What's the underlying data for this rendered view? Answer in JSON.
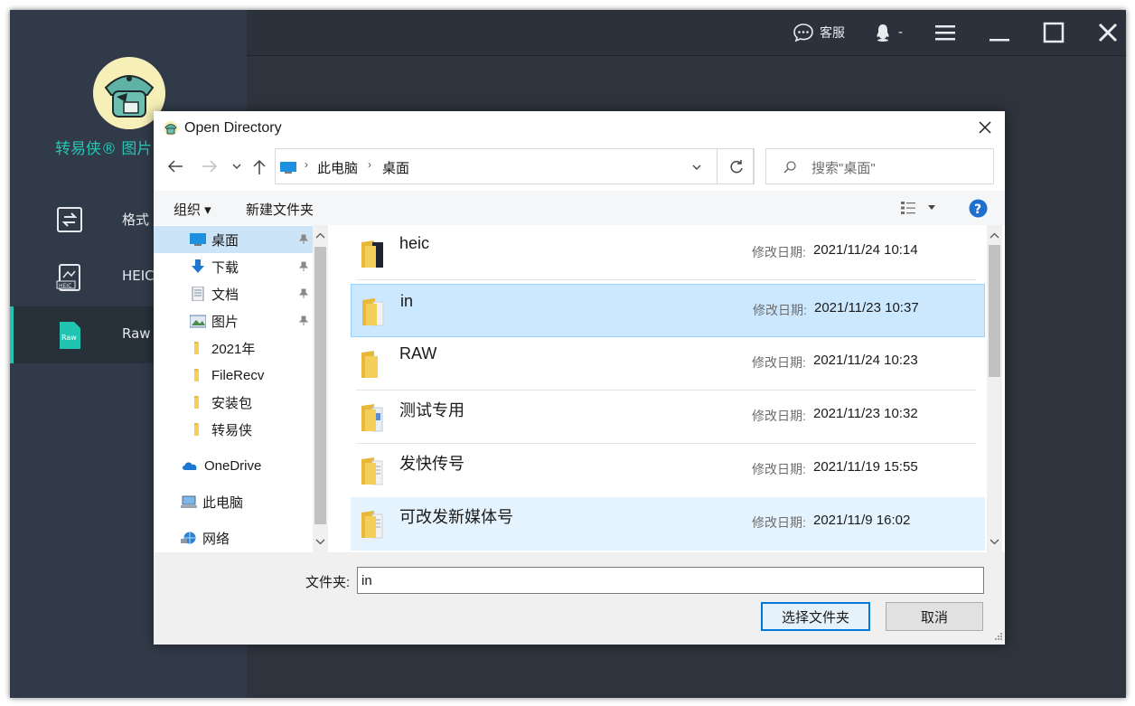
{
  "app": {
    "brand": "转易侠® 图片",
    "topbar": {
      "service_label": "客服",
      "user_label": "-"
    },
    "nav": [
      {
        "label": "格式",
        "icon": "convert-icon"
      },
      {
        "label": "HEIC",
        "icon": "heic-icon"
      },
      {
        "label": "Raw",
        "icon": "raw-icon"
      }
    ]
  },
  "dialog": {
    "title": "Open Directory",
    "breadcrumb": [
      "此电脑",
      "桌面"
    ],
    "search_placeholder": "搜索\"桌面\"",
    "toolbar": {
      "organize": "组织 ▾",
      "new_folder": "新建文件夹"
    },
    "tree": [
      {
        "label": "桌面",
        "pinned": true
      },
      {
        "label": "下载",
        "pinned": true
      },
      {
        "label": "文档",
        "pinned": true
      },
      {
        "label": "图片",
        "pinned": true
      },
      {
        "label": "2021年",
        "pinned": false
      },
      {
        "label": "FileRecv",
        "pinned": false
      },
      {
        "label": "安装包",
        "pinned": false
      },
      {
        "label": "转易侠",
        "pinned": false
      },
      {
        "label": "OneDrive",
        "pinned": false
      },
      {
        "label": "此电脑",
        "pinned": false
      },
      {
        "label": "网络",
        "pinned": false
      }
    ],
    "date_label": "修改日期:",
    "files": [
      {
        "name": "heic",
        "date": "2021/11/24 10:14"
      },
      {
        "name": "in",
        "date": "2021/11/23 10:37"
      },
      {
        "name": "RAW",
        "date": "2021/11/24 10:23"
      },
      {
        "name": "测试专用",
        "date": "2021/11/23 10:32"
      },
      {
        "name": "发快传号",
        "date": "2021/11/19 15:55"
      },
      {
        "name": "可改发新媒体号",
        "date": "2021/11/9 16:02"
      }
    ],
    "folder_label": "文件夹:",
    "folder_value": "in",
    "select_button": "选择文件夹",
    "cancel_button": "取消"
  }
}
